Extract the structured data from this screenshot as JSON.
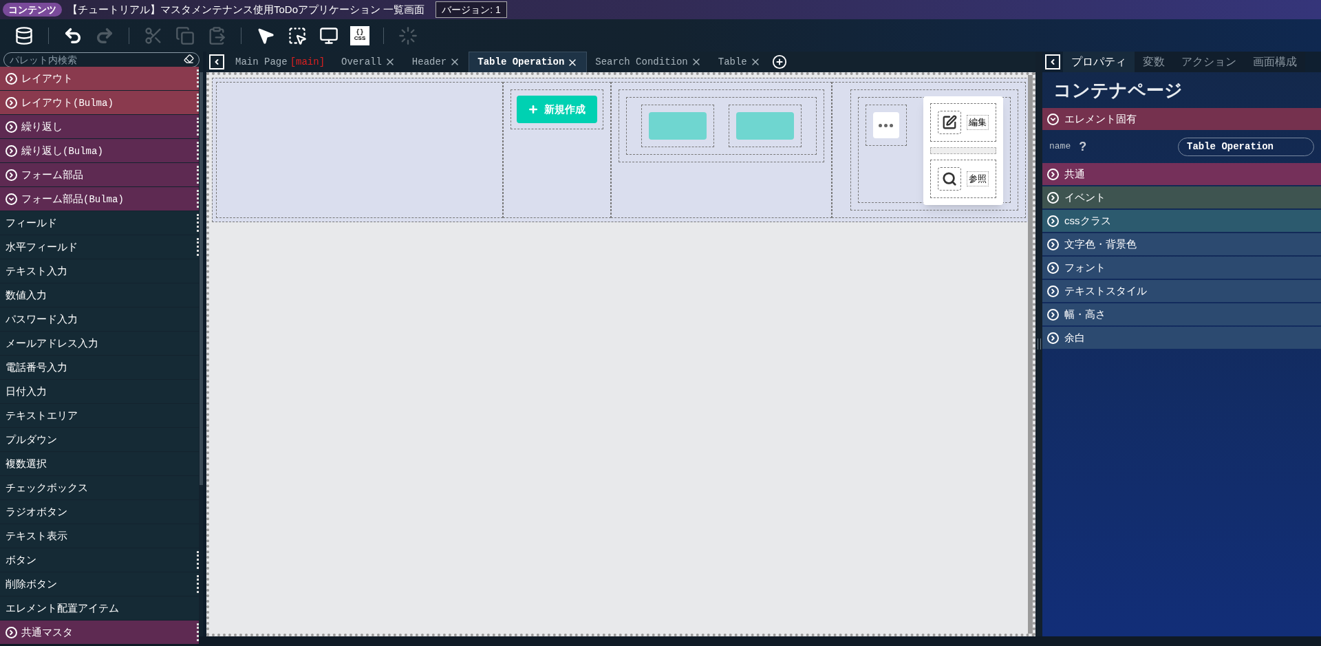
{
  "title_bar": {
    "badge": "コンテンツ",
    "title": "【チュートリアル】マスタメンテナンス使用ToDoアプリケーション 一覧画面",
    "version": "バージョン: 1"
  },
  "toolbar": [
    {
      "kind": "database",
      "disabled": false
    },
    {
      "kind": "separator"
    },
    {
      "kind": "undo",
      "disabled": false
    },
    {
      "kind": "redo",
      "disabled": true
    },
    {
      "kind": "separator"
    },
    {
      "kind": "cut",
      "disabled": true
    },
    {
      "kind": "copy",
      "disabled": true
    },
    {
      "kind": "paste",
      "disabled": true
    },
    {
      "kind": "separator"
    },
    {
      "kind": "pointer",
      "disabled": false
    },
    {
      "kind": "select",
      "disabled": false
    },
    {
      "kind": "preview",
      "disabled": false
    },
    {
      "kind": "css",
      "disabled": false,
      "glyph_top": "{}",
      "glyph_bottom": "CSS"
    },
    {
      "kind": "separator"
    },
    {
      "kind": "spinner",
      "disabled": true
    }
  ],
  "palette": {
    "search": {
      "placeholder": "パレット内検索"
    },
    "items": [
      {
        "kind": "category",
        "label": "レイアウト",
        "expanded": false,
        "color": "#8a3a4e",
        "handle": true
      },
      {
        "kind": "category",
        "label": "レイアウト",
        "suffix": "(Bulma)",
        "expanded": false,
        "color": "#8a3a4e",
        "handle": true
      },
      {
        "kind": "category",
        "label": "繰り返し",
        "expanded": false,
        "color": "#5e2a52",
        "handle": true
      },
      {
        "kind": "category",
        "label": "繰り返し",
        "suffix": "(Bulma)",
        "expanded": false,
        "color": "#5e2a52",
        "handle": true
      },
      {
        "kind": "category",
        "label": "フォーム部品",
        "expanded": false,
        "color": "#5e2a52",
        "handle": true
      },
      {
        "kind": "category",
        "label": "フォーム部品",
        "suffix": "(Bulma)",
        "expanded": true,
        "color": "#5e2a52",
        "handle": true
      },
      {
        "kind": "item",
        "label": "フィールド",
        "handle": true
      },
      {
        "kind": "item",
        "label": "水平フィールド",
        "handle": true
      },
      {
        "kind": "item",
        "label": "テキスト入力",
        "handle": false
      },
      {
        "kind": "item",
        "label": "数値入力",
        "handle": false
      },
      {
        "kind": "item",
        "label": "パスワード入力",
        "handle": false
      },
      {
        "kind": "item",
        "label": "メールアドレス入力",
        "handle": false
      },
      {
        "kind": "item",
        "label": "電話番号入力",
        "handle": false
      },
      {
        "kind": "item",
        "label": "日付入力",
        "handle": false
      },
      {
        "kind": "item",
        "label": "テキストエリア",
        "handle": false
      },
      {
        "kind": "item",
        "label": "プルダウン",
        "handle": false
      },
      {
        "kind": "item",
        "label": "複数選択",
        "handle": false
      },
      {
        "kind": "item",
        "label": "チェックボックス",
        "handle": false
      },
      {
        "kind": "item",
        "label": "ラジオボタン",
        "handle": false
      },
      {
        "kind": "item",
        "label": "テキスト表示",
        "handle": false
      },
      {
        "kind": "item",
        "label": "ボタン",
        "handle": true
      },
      {
        "kind": "item",
        "label": "削除ボタン",
        "handle": true
      },
      {
        "kind": "item",
        "label": "エレメント配置アイテム",
        "handle": false
      },
      {
        "kind": "category",
        "label": "共通マスタ",
        "expanded": false,
        "color": "#5e2a52",
        "handle": true
      }
    ]
  },
  "editor_tabs": [
    {
      "label": "Main Page",
      "badge": "[main]",
      "closable": false,
      "selected": false
    },
    {
      "label": "Overall",
      "closable": true,
      "selected": false
    },
    {
      "label": "Header",
      "closable": true,
      "selected": false
    },
    {
      "label": "Table Operation",
      "closable": true,
      "selected": true
    },
    {
      "label": "Search Condition",
      "closable": true,
      "selected": false
    },
    {
      "label": "Table",
      "closable": true,
      "selected": false
    }
  ],
  "canvas": {
    "new_button": "新規作成",
    "menu_items": [
      {
        "kind": "edit",
        "label": "編集"
      },
      {
        "kind": "view",
        "label": "参照"
      }
    ]
  },
  "properties": {
    "tabs": [
      {
        "label": "プロパティ",
        "selected": true
      },
      {
        "label": "変数",
        "selected": false
      },
      {
        "label": "アクション",
        "selected": false
      },
      {
        "label": "画面構成",
        "selected": false
      }
    ],
    "heading": "コンテナページ",
    "sections": [
      {
        "label": "エレメント固有",
        "expanded": true,
        "color": "#75314e",
        "fields": [
          {
            "label": "name",
            "help": "?",
            "value": "Table Operation"
          }
        ]
      },
      {
        "label": "共通",
        "expanded": false,
        "color": "#75305a"
      },
      {
        "label": "イベント",
        "expanded": false,
        "color": "#3e5450"
      },
      {
        "label": "cssクラス",
        "expanded": false,
        "color": "#2c5a6e"
      },
      {
        "label": "文字色・背景色",
        "expanded": false,
        "color": "#2c4a70"
      },
      {
        "label": "フォント",
        "expanded": false,
        "color": "#2c4a70"
      },
      {
        "label": "テキストスタイル",
        "expanded": false,
        "color": "#2c4a70"
      },
      {
        "label": "幅・高さ",
        "expanded": false,
        "color": "#2c4a70"
      },
      {
        "label": "余白",
        "expanded": false,
        "color": "#2c4a70"
      }
    ]
  }
}
